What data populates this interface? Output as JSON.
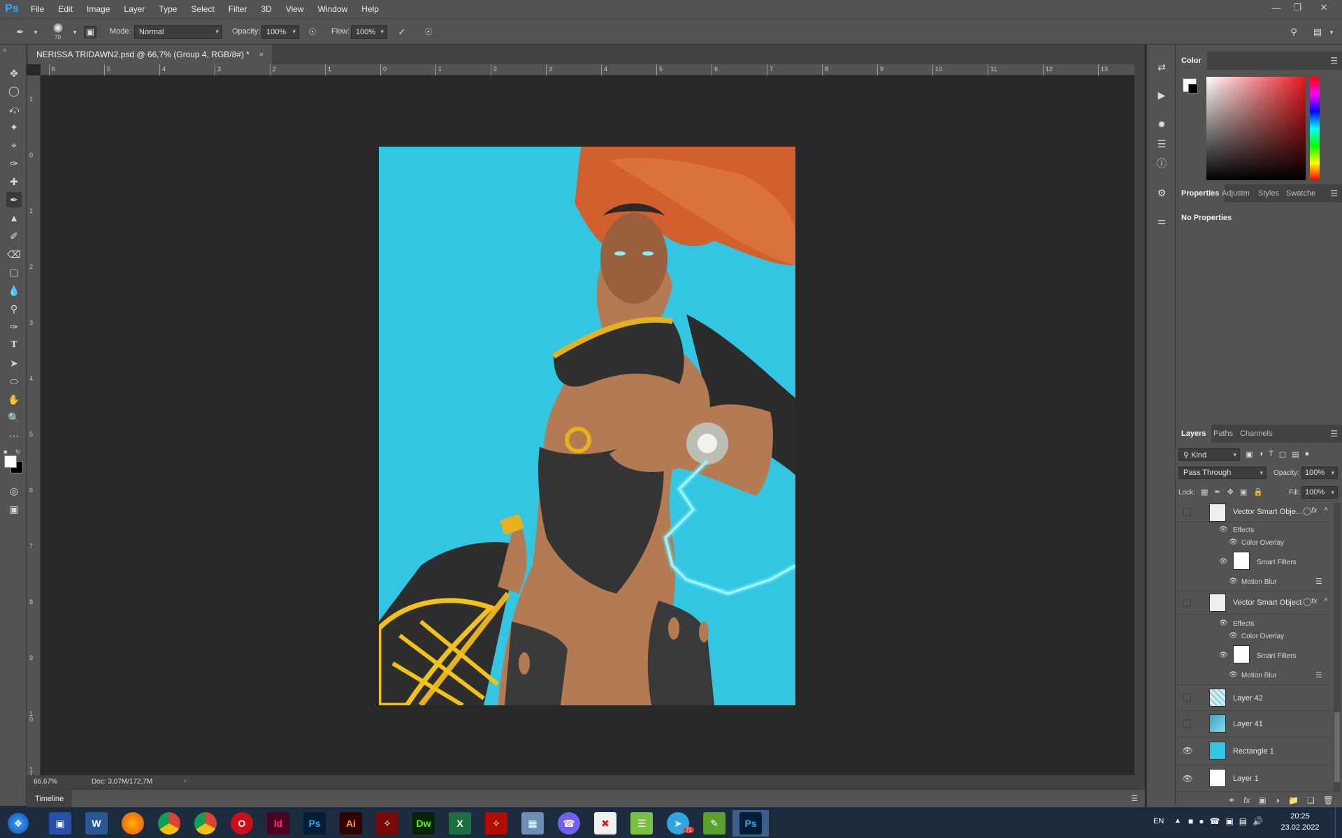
{
  "app": {
    "logo": "Ps",
    "menu": [
      "File",
      "Edit",
      "Image",
      "Layer",
      "Type",
      "Select",
      "Filter",
      "3D",
      "View",
      "Window",
      "Help"
    ],
    "window_controls": [
      "minimize-icon",
      "restore-icon",
      "close-icon"
    ]
  },
  "options_bar": {
    "brush_size": "70",
    "mode_label": "Mode:",
    "mode_value": "Normal",
    "opacity_label": "Opacity:",
    "opacity_value": "100%",
    "flow_label": "Flow:",
    "flow_value": "100%"
  },
  "document": {
    "tab_title": "NERISSA TRIDAWN2.psd @ 66,7% (Group 4, RGB/8#) *",
    "zoom": "66,67%",
    "doc_info": "Doc: 3,07M/172,7M",
    "ruler_h": [
      "6",
      "5",
      "4",
      "3",
      "2",
      "1",
      "0",
      "1",
      "2",
      "3",
      "4",
      "5",
      "6",
      "7",
      "8",
      "9",
      "10",
      "11",
      "12",
      "13"
    ],
    "ruler_v": [
      "1",
      "0",
      "1",
      "2",
      "3",
      "4",
      "5",
      "6",
      "7",
      "8",
      "9",
      "1 0",
      "1 1"
    ],
    "timeline_label": "Timeline"
  },
  "panels": {
    "color": {
      "title": "Color"
    },
    "properties": {
      "tabs": [
        "Properties",
        "Adjustm",
        "Styles",
        "Swatche"
      ],
      "content": "No Properties"
    },
    "layers": {
      "tabs": [
        "Layers",
        "Paths",
        "Channels"
      ],
      "filter_kind": "Kind",
      "blend_mode": "Pass Through",
      "opacity_label": "Opacity:",
      "opacity_value": "100%",
      "lock_label": "Lock:",
      "fill_label": "Fill:",
      "fill_value": "100%",
      "items": [
        {
          "name": "Vector Smart Obje...",
          "fx": "fx",
          "eye": false
        },
        {
          "name": "Effects"
        },
        {
          "name": "Color Overlay"
        },
        {
          "name": "Smart Filters"
        },
        {
          "name": "Motion Blur"
        },
        {
          "name": "Vector Smart Object",
          "fx": "fx",
          "eye": false
        },
        {
          "name": "Effects"
        },
        {
          "name": "Color Overlay"
        },
        {
          "name": "Smart Filters"
        },
        {
          "name": "Motion Blur"
        },
        {
          "name": "Layer 42",
          "eye": false
        },
        {
          "name": "Layer 41",
          "eye": false
        },
        {
          "name": "Rectangle 1",
          "eye": true
        },
        {
          "name": "Layer 1",
          "eye": true
        }
      ]
    }
  },
  "taskbar": {
    "apps": [
      "Start",
      "Save",
      "W",
      "Firefox",
      "Chrome",
      "Chrome",
      "Opera",
      "Id",
      "Ps",
      "Ai",
      "Acrobat",
      "Dw",
      "Excel",
      "Acrobat",
      "Calculator",
      "Viber",
      "App",
      "Stack",
      "Telegram",
      "Notepad",
      "Ps"
    ],
    "telegram_badge": "71",
    "lang": "EN",
    "time": "20:25",
    "date": "23.02.2022"
  },
  "colors": {
    "artwork_bg": "#33c6e2",
    "hair": "#d2602e",
    "ps_blue": "#31a8ff"
  }
}
